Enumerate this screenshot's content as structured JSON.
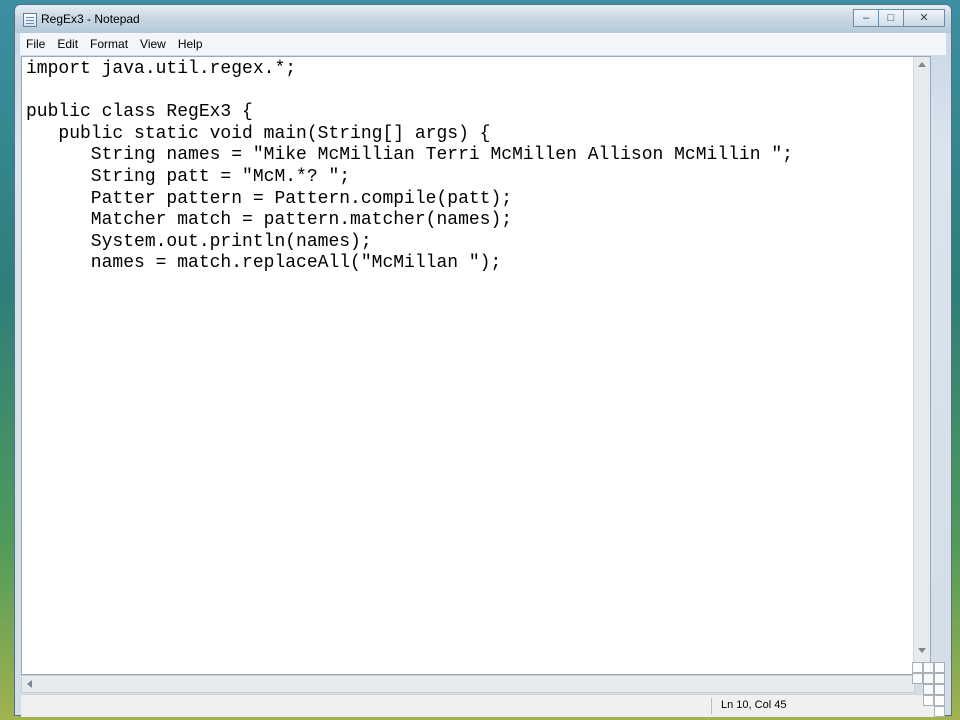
{
  "window": {
    "title": "RegEx3 - Notepad",
    "buttons": {
      "minimize": "–",
      "maximize": "□",
      "close": "✕"
    }
  },
  "menu": {
    "items": [
      "File",
      "Edit",
      "Format",
      "View",
      "Help"
    ]
  },
  "editor": {
    "lines": [
      "import java.util.regex.*;",
      "",
      "public class RegEx3 {",
      "   public static void main(String[] args) {",
      "      String names = \"Mike McMillian Terri McMillen Allison McMillin \";",
      "      String patt = \"McM.*? \";",
      "      Patter pattern = Pattern.compile(patt);",
      "      Matcher match = pattern.matcher(names);",
      "      System.out.println(names);",
      "      names = match.replaceAll(\"McMillan \");"
    ]
  },
  "statusbar": {
    "position": "Ln 10, Col 45"
  },
  "icons": {
    "app": "notepad-icon",
    "scroll_up": "arrow-up-icon",
    "scroll_down": "arrow-down-icon",
    "scroll_left": "arrow-left-icon",
    "grip": "resize-grip-icon"
  }
}
